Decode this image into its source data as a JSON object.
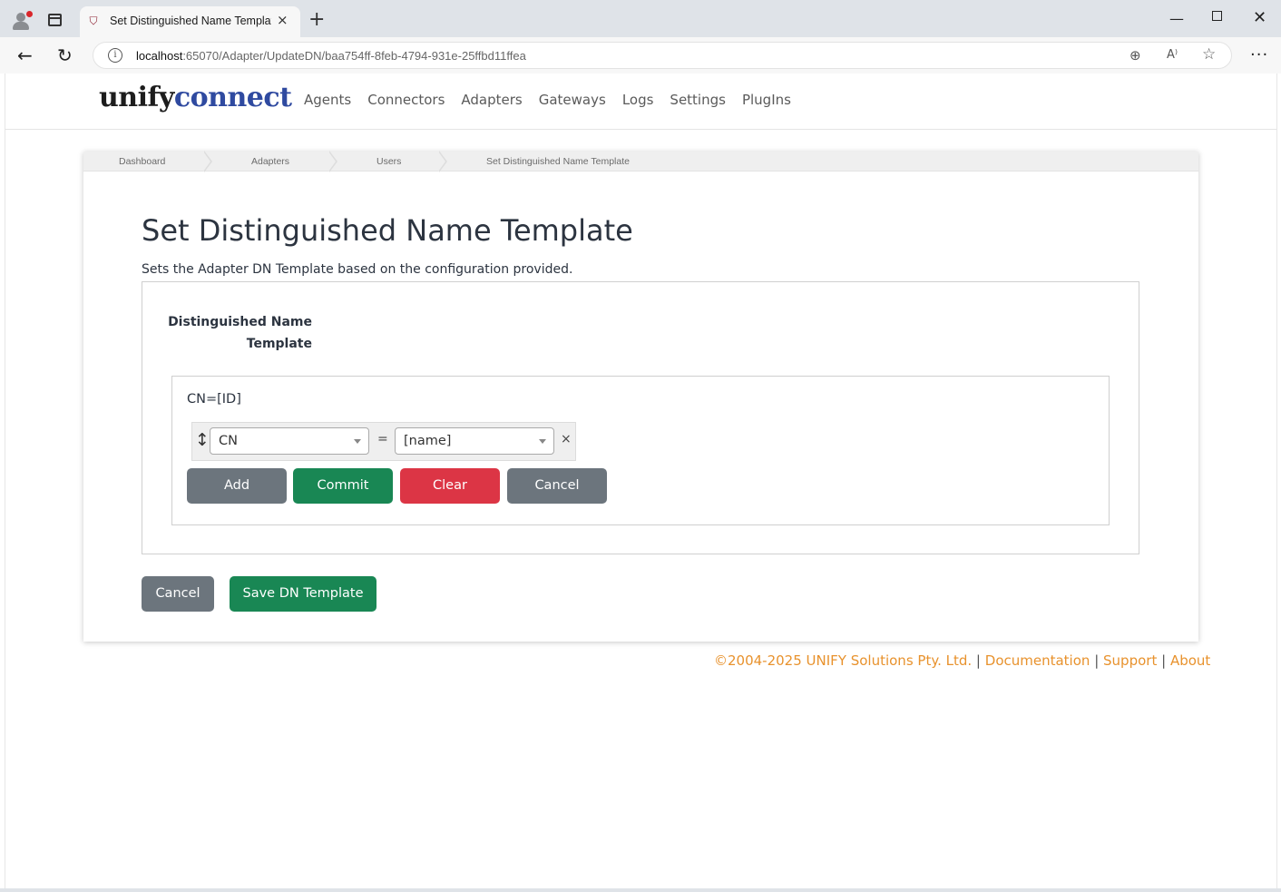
{
  "browser": {
    "tab_title": "Set Distinguished Name Template",
    "tab_close": "×",
    "new_tab": "+",
    "url_host": "localhost",
    "url_rest": ":65070/Adapter/UpdateDN/baa754ff-8feb-4794-931e-25ffbd11ffea",
    "icons": [
      "profile-icon",
      "tabs-icon",
      "back-icon",
      "refresh-icon",
      "info-icon",
      "zoom-icon",
      "read-aloud-icon",
      "favorite-icon",
      "menu-icon",
      "minimize-icon",
      "maximize-icon",
      "close-icon"
    ]
  },
  "app": {
    "logo_part1": "unify",
    "logo_part2": "connect",
    "nav": [
      "Agents",
      "Connectors",
      "Adapters",
      "Gateways",
      "Logs",
      "Settings",
      "PlugIns"
    ]
  },
  "breadcrumb": [
    "Dashboard",
    "Adapters",
    "Users",
    "Set Distinguished Name Template"
  ],
  "page": {
    "title": "Set Distinguished Name Template",
    "subtitle": "Sets the Adapter DN Template based on the configuration provided.",
    "field_label_line1": "Distinguished Name",
    "field_label_line2": "Template",
    "preview": "CN=[ID]",
    "row": {
      "attribute": "CN",
      "equals": "=",
      "value": "[name]",
      "remove": "×"
    },
    "builder_buttons": {
      "add": "Add",
      "commit": "Commit",
      "clear": "Clear",
      "cancel": "Cancel"
    },
    "actions": {
      "cancel": "Cancel",
      "save": "Save DN Template"
    }
  },
  "footer": {
    "copyright": "©2004-2025 UNIFY Solutions Pty. Ltd.",
    "separator": "|",
    "documentation": "Documentation",
    "support": "Support",
    "about": "About"
  },
  "colors": {
    "accent_green": "#198754",
    "danger_red": "#dc3545",
    "secondary_gray": "#6c757d",
    "footer_orange": "#e8922d",
    "logo_blue": "#2f4aa0"
  }
}
